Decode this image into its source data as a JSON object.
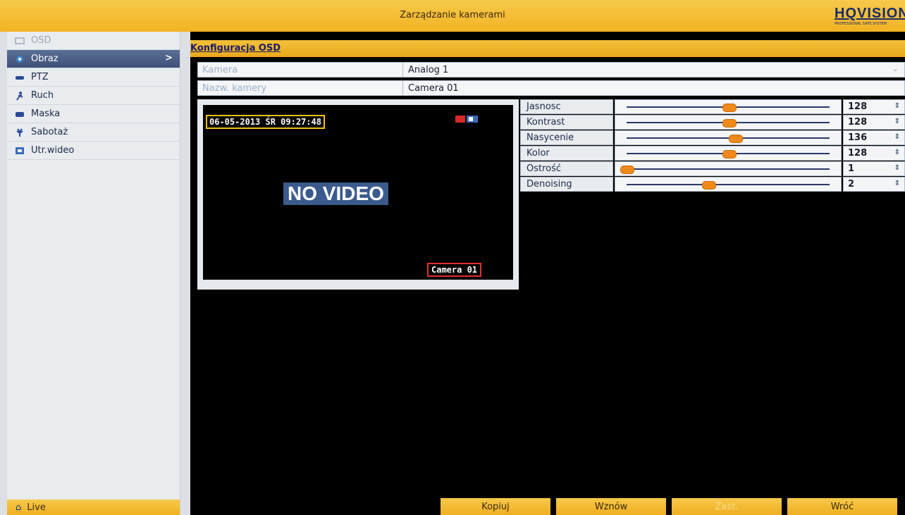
{
  "header": {
    "title": "Zarządzanie kamerami",
    "logo_text": "HQVISION",
    "logo_sub": "PROFESSIONAL SAFE SYSTEM"
  },
  "sidebar": {
    "items": [
      {
        "label": "OSD",
        "icon": "osd-icon"
      },
      {
        "label": "Obraz",
        "icon": "image-icon",
        "chevron": ">"
      },
      {
        "label": "PTZ",
        "icon": "ptz-icon"
      },
      {
        "label": "Ruch",
        "icon": "motion-icon"
      },
      {
        "label": "Maska",
        "icon": "mask-icon"
      },
      {
        "label": "Sabotaż",
        "icon": "tamper-icon"
      },
      {
        "label": "Utr.wideo",
        "icon": "video-loss-icon"
      }
    ],
    "live_label": "Live"
  },
  "main": {
    "section_title": "Konfiguracja OSD",
    "camera_label": "Kamera",
    "camera_value": "Analog 1",
    "name_label": "Nazw. kamery",
    "name_value": "Camera 01"
  },
  "preview": {
    "date_text": "06-05-2013 ŚR 09:27:48",
    "no_video": "NO VIDEO",
    "camera_osd": "Camera 01"
  },
  "adjustments": [
    {
      "label": "Jasnosc",
      "value": "128",
      "level": 0.5
    },
    {
      "label": "Kontrast",
      "value": "128",
      "level": 0.5
    },
    {
      "label": "Nasycenie",
      "value": "136",
      "level": 0.53
    },
    {
      "label": "Kolor",
      "value": "128",
      "level": 0.5
    },
    {
      "label": "Ostrość",
      "value": "1",
      "level": 0.0
    },
    {
      "label": "Denoising",
      "value": "2",
      "level": 0.4
    }
  ],
  "buttons": {
    "copy": "Kopiuj",
    "restore": "Wznów",
    "apply": "Zast.",
    "back": "Wróć"
  }
}
